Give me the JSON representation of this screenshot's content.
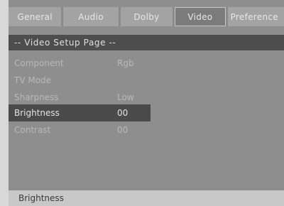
{
  "tabs": [
    {
      "label": "General"
    },
    {
      "label": "Audio"
    },
    {
      "label": "Dolby"
    },
    {
      "label": "Video"
    },
    {
      "label": "Preference"
    }
  ],
  "active_tab": "Video",
  "page_header": "-- Video Setup Page --",
  "menu": [
    {
      "label": "Component",
      "value": "Rgb"
    },
    {
      "label": "TV Mode",
      "value": ""
    },
    {
      "label": "Sharpness",
      "value": "Low"
    },
    {
      "label": "Brightness",
      "value": "00"
    },
    {
      "label": "Contrast",
      "value": "00"
    }
  ],
  "selected_item": "Brightness",
  "status_text": "Brightness"
}
